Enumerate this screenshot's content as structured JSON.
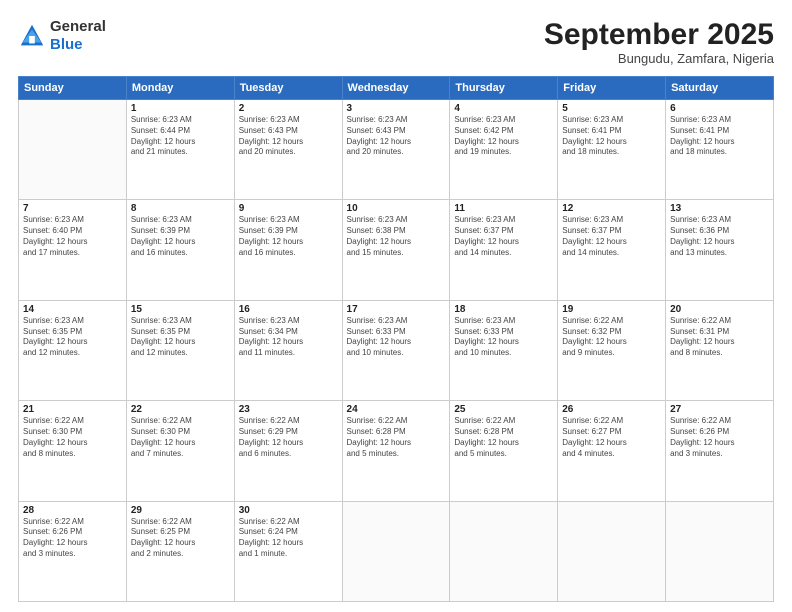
{
  "header": {
    "logo_general": "General",
    "logo_blue": "Blue",
    "month_title": "September 2025",
    "subtitle": "Bungudu, Zamfara, Nigeria"
  },
  "days_of_week": [
    "Sunday",
    "Monday",
    "Tuesday",
    "Wednesday",
    "Thursday",
    "Friday",
    "Saturday"
  ],
  "weeks": [
    [
      {
        "num": "",
        "info": ""
      },
      {
        "num": "1",
        "info": "Sunrise: 6:23 AM\nSunset: 6:44 PM\nDaylight: 12 hours\nand 21 minutes."
      },
      {
        "num": "2",
        "info": "Sunrise: 6:23 AM\nSunset: 6:43 PM\nDaylight: 12 hours\nand 20 minutes."
      },
      {
        "num": "3",
        "info": "Sunrise: 6:23 AM\nSunset: 6:43 PM\nDaylight: 12 hours\nand 20 minutes."
      },
      {
        "num": "4",
        "info": "Sunrise: 6:23 AM\nSunset: 6:42 PM\nDaylight: 12 hours\nand 19 minutes."
      },
      {
        "num": "5",
        "info": "Sunrise: 6:23 AM\nSunset: 6:41 PM\nDaylight: 12 hours\nand 18 minutes."
      },
      {
        "num": "6",
        "info": "Sunrise: 6:23 AM\nSunset: 6:41 PM\nDaylight: 12 hours\nand 18 minutes."
      }
    ],
    [
      {
        "num": "7",
        "info": "Sunrise: 6:23 AM\nSunset: 6:40 PM\nDaylight: 12 hours\nand 17 minutes."
      },
      {
        "num": "8",
        "info": "Sunrise: 6:23 AM\nSunset: 6:39 PM\nDaylight: 12 hours\nand 16 minutes."
      },
      {
        "num": "9",
        "info": "Sunrise: 6:23 AM\nSunset: 6:39 PM\nDaylight: 12 hours\nand 16 minutes."
      },
      {
        "num": "10",
        "info": "Sunrise: 6:23 AM\nSunset: 6:38 PM\nDaylight: 12 hours\nand 15 minutes."
      },
      {
        "num": "11",
        "info": "Sunrise: 6:23 AM\nSunset: 6:37 PM\nDaylight: 12 hours\nand 14 minutes."
      },
      {
        "num": "12",
        "info": "Sunrise: 6:23 AM\nSunset: 6:37 PM\nDaylight: 12 hours\nand 14 minutes."
      },
      {
        "num": "13",
        "info": "Sunrise: 6:23 AM\nSunset: 6:36 PM\nDaylight: 12 hours\nand 13 minutes."
      }
    ],
    [
      {
        "num": "14",
        "info": "Sunrise: 6:23 AM\nSunset: 6:35 PM\nDaylight: 12 hours\nand 12 minutes."
      },
      {
        "num": "15",
        "info": "Sunrise: 6:23 AM\nSunset: 6:35 PM\nDaylight: 12 hours\nand 12 minutes."
      },
      {
        "num": "16",
        "info": "Sunrise: 6:23 AM\nSunset: 6:34 PM\nDaylight: 12 hours\nand 11 minutes."
      },
      {
        "num": "17",
        "info": "Sunrise: 6:23 AM\nSunset: 6:33 PM\nDaylight: 12 hours\nand 10 minutes."
      },
      {
        "num": "18",
        "info": "Sunrise: 6:23 AM\nSunset: 6:33 PM\nDaylight: 12 hours\nand 10 minutes."
      },
      {
        "num": "19",
        "info": "Sunrise: 6:22 AM\nSunset: 6:32 PM\nDaylight: 12 hours\nand 9 minutes."
      },
      {
        "num": "20",
        "info": "Sunrise: 6:22 AM\nSunset: 6:31 PM\nDaylight: 12 hours\nand 8 minutes."
      }
    ],
    [
      {
        "num": "21",
        "info": "Sunrise: 6:22 AM\nSunset: 6:30 PM\nDaylight: 12 hours\nand 8 minutes."
      },
      {
        "num": "22",
        "info": "Sunrise: 6:22 AM\nSunset: 6:30 PM\nDaylight: 12 hours\nand 7 minutes."
      },
      {
        "num": "23",
        "info": "Sunrise: 6:22 AM\nSunset: 6:29 PM\nDaylight: 12 hours\nand 6 minutes."
      },
      {
        "num": "24",
        "info": "Sunrise: 6:22 AM\nSunset: 6:28 PM\nDaylight: 12 hours\nand 5 minutes."
      },
      {
        "num": "25",
        "info": "Sunrise: 6:22 AM\nSunset: 6:28 PM\nDaylight: 12 hours\nand 5 minutes."
      },
      {
        "num": "26",
        "info": "Sunrise: 6:22 AM\nSunset: 6:27 PM\nDaylight: 12 hours\nand 4 minutes."
      },
      {
        "num": "27",
        "info": "Sunrise: 6:22 AM\nSunset: 6:26 PM\nDaylight: 12 hours\nand 3 minutes."
      }
    ],
    [
      {
        "num": "28",
        "info": "Sunrise: 6:22 AM\nSunset: 6:26 PM\nDaylight: 12 hours\nand 3 minutes."
      },
      {
        "num": "29",
        "info": "Sunrise: 6:22 AM\nSunset: 6:25 PM\nDaylight: 12 hours\nand 2 minutes."
      },
      {
        "num": "30",
        "info": "Sunrise: 6:22 AM\nSunset: 6:24 PM\nDaylight: 12 hours\nand 1 minute."
      },
      {
        "num": "",
        "info": ""
      },
      {
        "num": "",
        "info": ""
      },
      {
        "num": "",
        "info": ""
      },
      {
        "num": "",
        "info": ""
      }
    ]
  ]
}
